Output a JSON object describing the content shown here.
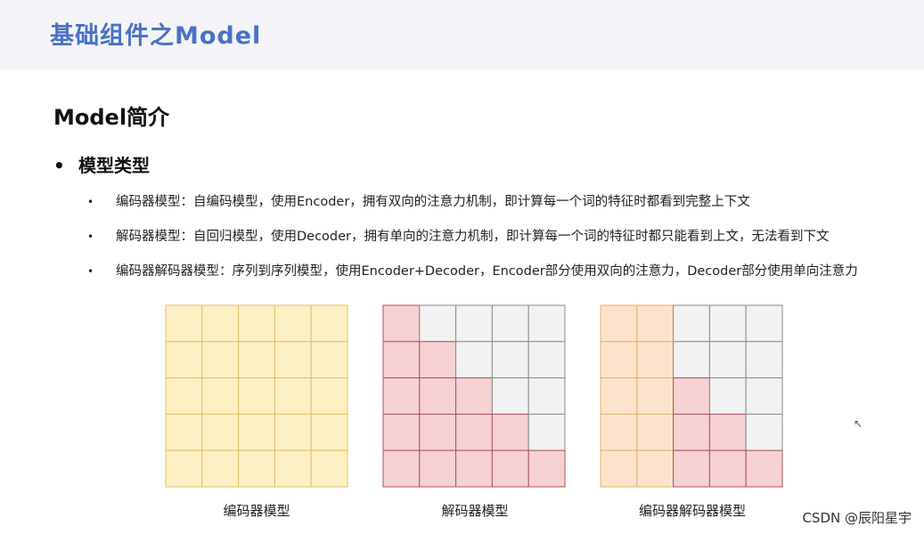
{
  "header": {
    "title": "基础组件之Model"
  },
  "section": {
    "title": "Model简介"
  },
  "bullet": {
    "marker": "•",
    "label": "模型类型"
  },
  "sub_items": [
    {
      "marker": "•",
      "text": "编码器模型：自编码模型，使用Encoder，拥有双向的注意力机制，即计算每一个词的特征时都看到完整上下文"
    },
    {
      "marker": "•",
      "text": "解码器模型：自回归模型，使用Decoder，拥有单向的注意力机制，即计算每一个词的特征时都只能看到上文，无法看到下文"
    },
    {
      "marker": "•",
      "text": "编码器解码器模型：序列到序列模型，使用Encoder+Decoder，Encoder部分使用双向的注意力，Decoder部分使用单向注意力"
    }
  ],
  "diagrams": [
    {
      "caption": "编码器模型",
      "mask": "full"
    },
    {
      "caption": "解码器模型",
      "mask": "causal"
    },
    {
      "caption": "编码器解码器模型",
      "mask": "prefix",
      "prefix_cols": 2
    }
  ],
  "colors": {
    "encoder_fill": "#fdf0c4",
    "encoder_stroke": "#e0c068",
    "decoder_fill": "#f6d2d4",
    "decoder_stroke": "#b0505a",
    "prefix_fill": "#fde3cc",
    "prefix_stroke": "#e0b070",
    "masked_fill": "#f2f2f2",
    "masked_stroke": "#8a8a8a"
  },
  "cursor_icon": "mouse-cursor-icon",
  "watermark": "CSDN @辰阳星宇"
}
